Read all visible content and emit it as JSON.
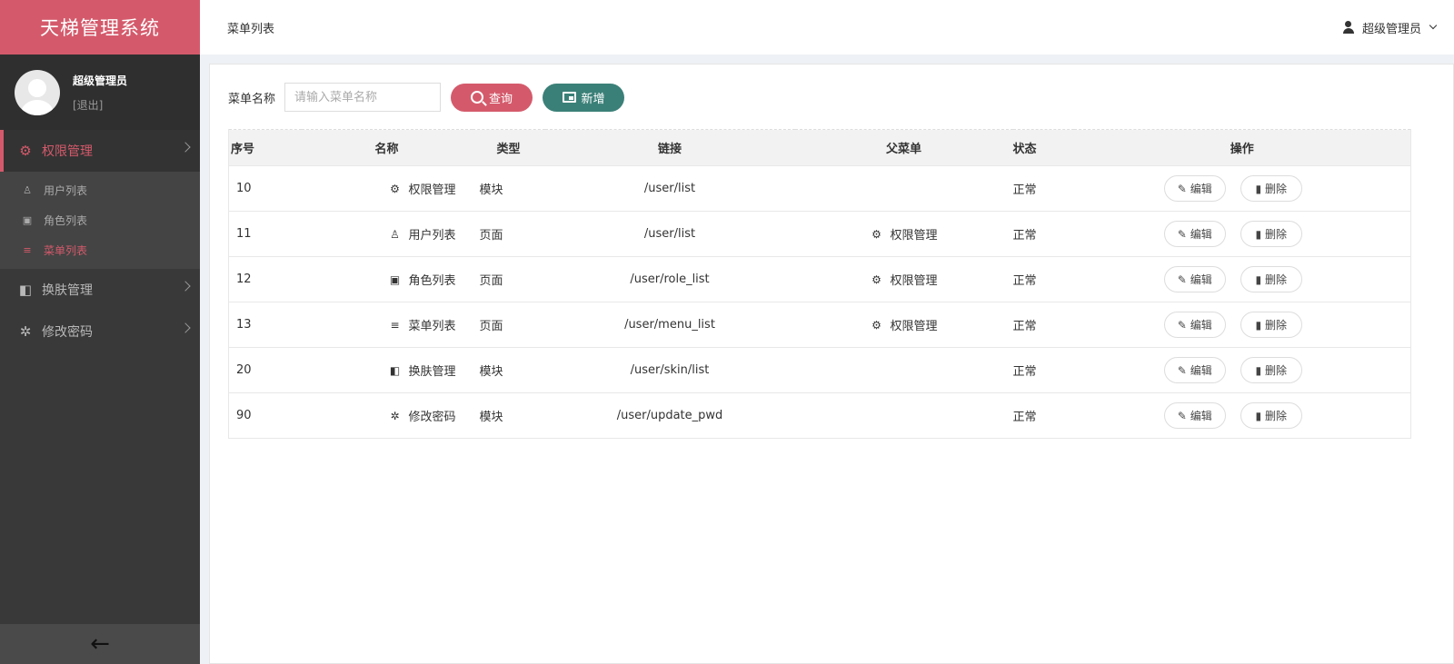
{
  "app": {
    "title": "天梯管理系统"
  },
  "user": {
    "name": "超级管理员",
    "logout": "[退出]"
  },
  "sidebar": {
    "menus": [
      {
        "label": "权限管理",
        "icon": "gear-icon",
        "active": true,
        "children": [
          {
            "label": "用户列表",
            "icon": "user-icon"
          },
          {
            "label": "角色列表",
            "icon": "id-card-icon"
          },
          {
            "label": "菜单列表",
            "icon": "list-icon",
            "active": true
          }
        ]
      },
      {
        "label": "换肤管理",
        "icon": "skin-icon"
      },
      {
        "label": "修改密码",
        "icon": "cog-icon"
      }
    ],
    "collapse_icon": "arrow-left-icon"
  },
  "header": {
    "breadcrumb": "菜单列表",
    "account": "超级管理员"
  },
  "search": {
    "label": "菜单名称",
    "placeholder": "请输入菜单名称",
    "value": "",
    "query_label": "查询",
    "add_label": "新增"
  },
  "table": {
    "columns": [
      "序号",
      "名称",
      "类型",
      "链接",
      "父菜单",
      "状态",
      "操作"
    ],
    "edit_label": "编辑",
    "delete_label": "删除",
    "rows": [
      {
        "id": "10",
        "name": "权限管理",
        "icon": "gear-icon",
        "type": "模块",
        "link": "/user/list",
        "parent": "",
        "status": "正常"
      },
      {
        "id": "11",
        "name": "用户列表",
        "icon": "user-icon",
        "type": "页面",
        "link": "/user/list",
        "parent": "权限管理",
        "status": "正常"
      },
      {
        "id": "12",
        "name": "角色列表",
        "icon": "id-card-icon",
        "type": "页面",
        "link": "/user/role_list",
        "parent": "权限管理",
        "status": "正常"
      },
      {
        "id": "13",
        "name": "菜单列表",
        "icon": "list-icon",
        "type": "页面",
        "link": "/user/menu_list",
        "parent": "权限管理",
        "status": "正常"
      },
      {
        "id": "20",
        "name": "换肤管理",
        "icon": "skin-icon",
        "type": "模块",
        "link": "/user/skin/list",
        "parent": "",
        "status": "正常"
      },
      {
        "id": "90",
        "name": "修改密码",
        "icon": "cog-icon",
        "type": "模块",
        "link": "/user/update_pwd",
        "parent": "",
        "status": "正常"
      }
    ]
  },
  "colors": {
    "accent": "#d45a6b",
    "teal": "#3b8078",
    "sidebar": "#393939"
  }
}
